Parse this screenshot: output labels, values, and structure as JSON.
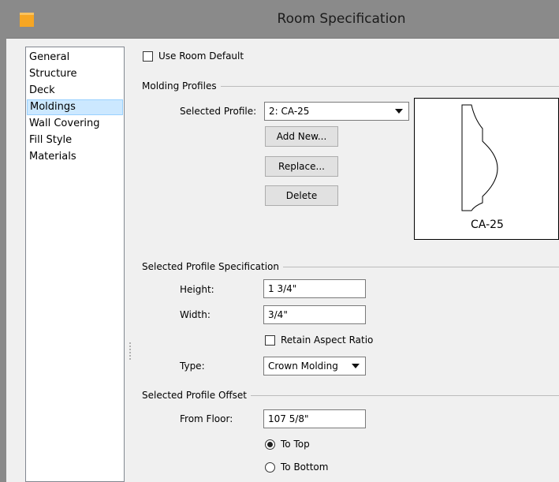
{
  "window": {
    "title": "Room Specification"
  },
  "nav": {
    "items": [
      {
        "label": "General"
      },
      {
        "label": "Structure"
      },
      {
        "label": "Deck"
      },
      {
        "label": "Moldings"
      },
      {
        "label": "Wall Covering"
      },
      {
        "label": "Fill Style"
      },
      {
        "label": "Materials"
      }
    ],
    "selected": "Moldings"
  },
  "use_room_default": {
    "label": "Use Room Default",
    "checked": false
  },
  "molding_profiles": {
    "title": "Molding Profiles",
    "selected_profile_label": "Selected Profile:",
    "selected_profile_value": "2:  CA-25",
    "add_new": "Add New...",
    "replace": "Replace...",
    "delete": "Delete",
    "preview_label": "CA-25"
  },
  "spec": {
    "title": "Selected Profile Specification",
    "height_label": "Height:",
    "height_value": "1 3/4\"",
    "width_label": "Width:",
    "width_value": "3/4\"",
    "retain_aspect": {
      "label": "Retain Aspect Ratio",
      "checked": false
    },
    "type_label": "Type:",
    "type_value": "Crown Molding"
  },
  "offset": {
    "title": "Selected Profile Offset",
    "from_floor_label": "From Floor:",
    "from_floor_value": "107 5/8\"",
    "to_top": {
      "label": "To Top",
      "checked": true
    },
    "to_bottom": {
      "label": "To Bottom",
      "checked": false
    }
  }
}
